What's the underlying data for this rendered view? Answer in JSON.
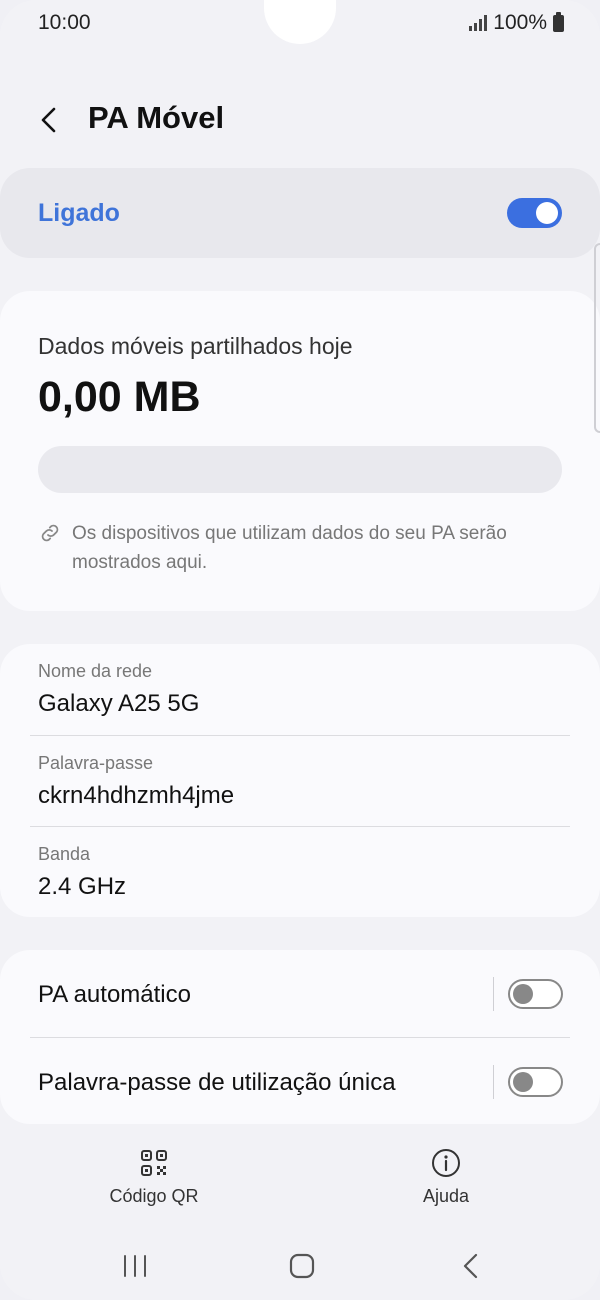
{
  "status_bar": {
    "time": "10:00",
    "battery": "100%"
  },
  "header": {
    "title": "PA Móvel",
    "back_icon": "back-arrow-icon"
  },
  "master": {
    "label": "Ligado",
    "enabled": true
  },
  "data_usage": {
    "label": "Dados móveis partilhados hoje",
    "value": "0,00 MB",
    "fill_fraction": 0,
    "hint": "Os dispositivos que utilizam dados do seu PA serão mostrados aqui."
  },
  "network": {
    "name_label": "Nome da rede",
    "name_value": "Galaxy A25 5G",
    "password_label": "Palavra-passe",
    "password_value": "ckrn4hdhzmh4jme",
    "band_label": "Banda",
    "band_value": "2.4 GHz"
  },
  "options": {
    "auto_label": "PA automático",
    "auto_enabled": false,
    "one_time_label": "Palavra-passe de utilização única",
    "one_time_enabled": false
  },
  "actions": {
    "qr_label": "Código QR",
    "help_label": "Ajuda"
  },
  "colors": {
    "accent": "#3b6fe0",
    "label_accent": "#3f74d9"
  }
}
